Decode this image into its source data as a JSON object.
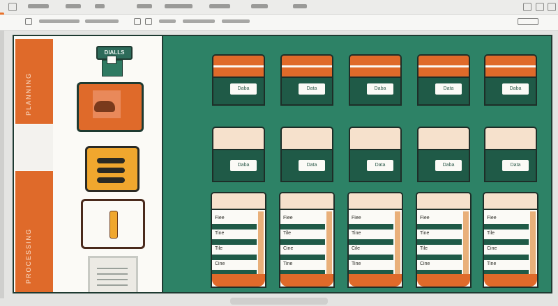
{
  "window": {
    "menu_items": [
      "—",
      "————",
      "—",
      "————",
      "——",
      "——————",
      "———",
      "————"
    ],
    "toolbar_items": [
      "——————",
      "——————",
      "———",
      "——————",
      "————"
    ]
  },
  "slide": {
    "rail_upper_text": "PLANNING",
    "rail_lower_text": "PROCESSING",
    "badge_label": "DIALLS",
    "cabinet_rows": [
      {
        "labels": [
          "Daba",
          "Data",
          "Daba",
          "Data",
          "Daba"
        ],
        "top_color": "#df6a2a"
      },
      {
        "labels": [
          "Daba",
          "Data",
          "Data",
          "Daba",
          "Data"
        ],
        "top_color": "#f6e1cc"
      }
    ],
    "ledgers": [
      {
        "lines": [
          "Fiee",
          "Tine",
          "Tile",
          "Cine"
        ]
      },
      {
        "lines": [
          "Fiee",
          "Tile",
          "Cine",
          "Tine"
        ]
      },
      {
        "lines": [
          "Fiee",
          "Tine",
          "Cile",
          "Tine"
        ]
      },
      {
        "lines": [
          "Fiee",
          "Tine",
          "Tile",
          "Cine"
        ]
      },
      {
        "lines": [
          "Fiee",
          "Tile",
          "Cine",
          "Tine"
        ]
      }
    ]
  },
  "colors": {
    "accent_orange": "#df6a2a",
    "panel_green": "#2d8266",
    "dark_green": "#1f5a47",
    "cream": "#f6e1cc",
    "amber": "#f0a72e"
  }
}
